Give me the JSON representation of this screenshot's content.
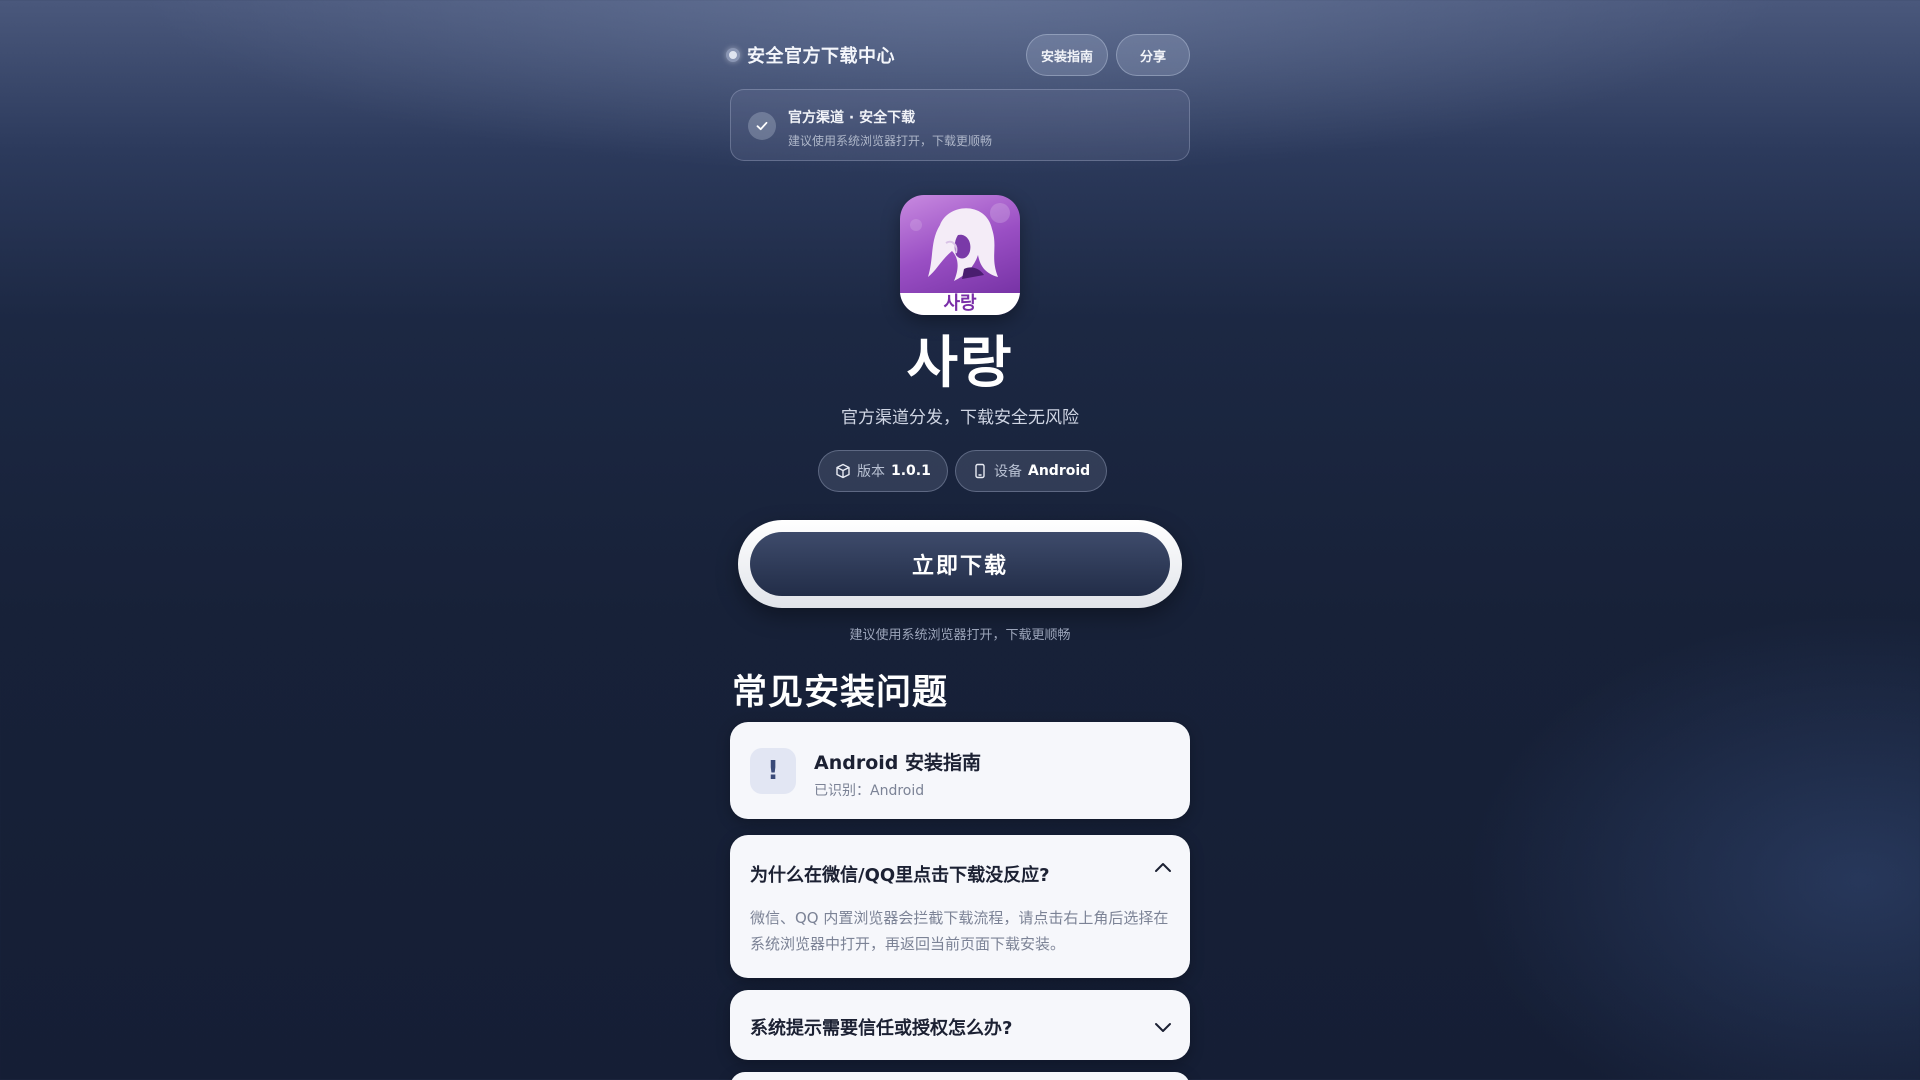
{
  "header": {
    "brand_title": "安全官方下载中心",
    "guide_button": "安装指南",
    "share_button": "分享"
  },
  "safety_banner": {
    "title": "官方渠道 · 安全下载",
    "subtitle": "建议使用系统浏览器打开，下载更顺畅"
  },
  "app": {
    "icon_label": "사랑",
    "name": "사랑",
    "tagline": "官方渠道分发，下载安全无风险",
    "version_label": "版本",
    "version_value": "1.0.1",
    "device_label": "设备",
    "device_value": "Android"
  },
  "download": {
    "button_label": "立即下载",
    "hint": "建议使用系统浏览器打开，下载更顺畅"
  },
  "faq": {
    "heading": "常见安装问题",
    "guide_card": {
      "icon": "!",
      "title": "Android 安装指南",
      "subtitle": "已识别：Android"
    },
    "items": [
      {
        "question": "为什么在微信/QQ里点击下载没反应?",
        "answer": "微信、QQ 内置浏览器会拦截下载流程，请点击右上角后选择在系统浏览器中打开，再返回当前页面下载安装。",
        "expanded": true
      },
      {
        "question": "系统提示需要信任或授权怎么办?",
        "expanded": false
      }
    ]
  },
  "colors": {
    "background_top": "#4a587c",
    "background_bottom": "#151e35",
    "button_dark": "#2a3553",
    "card_bg": "#f6f7fb",
    "icon_purple": "#9a4fc4"
  },
  "icons": {
    "brand": "status-dot-icon",
    "safety": "check-icon",
    "version": "box-icon",
    "device": "phone-icon",
    "faq_expanded": "chevron-up-icon",
    "faq_collapsed": "chevron-down-icon"
  }
}
